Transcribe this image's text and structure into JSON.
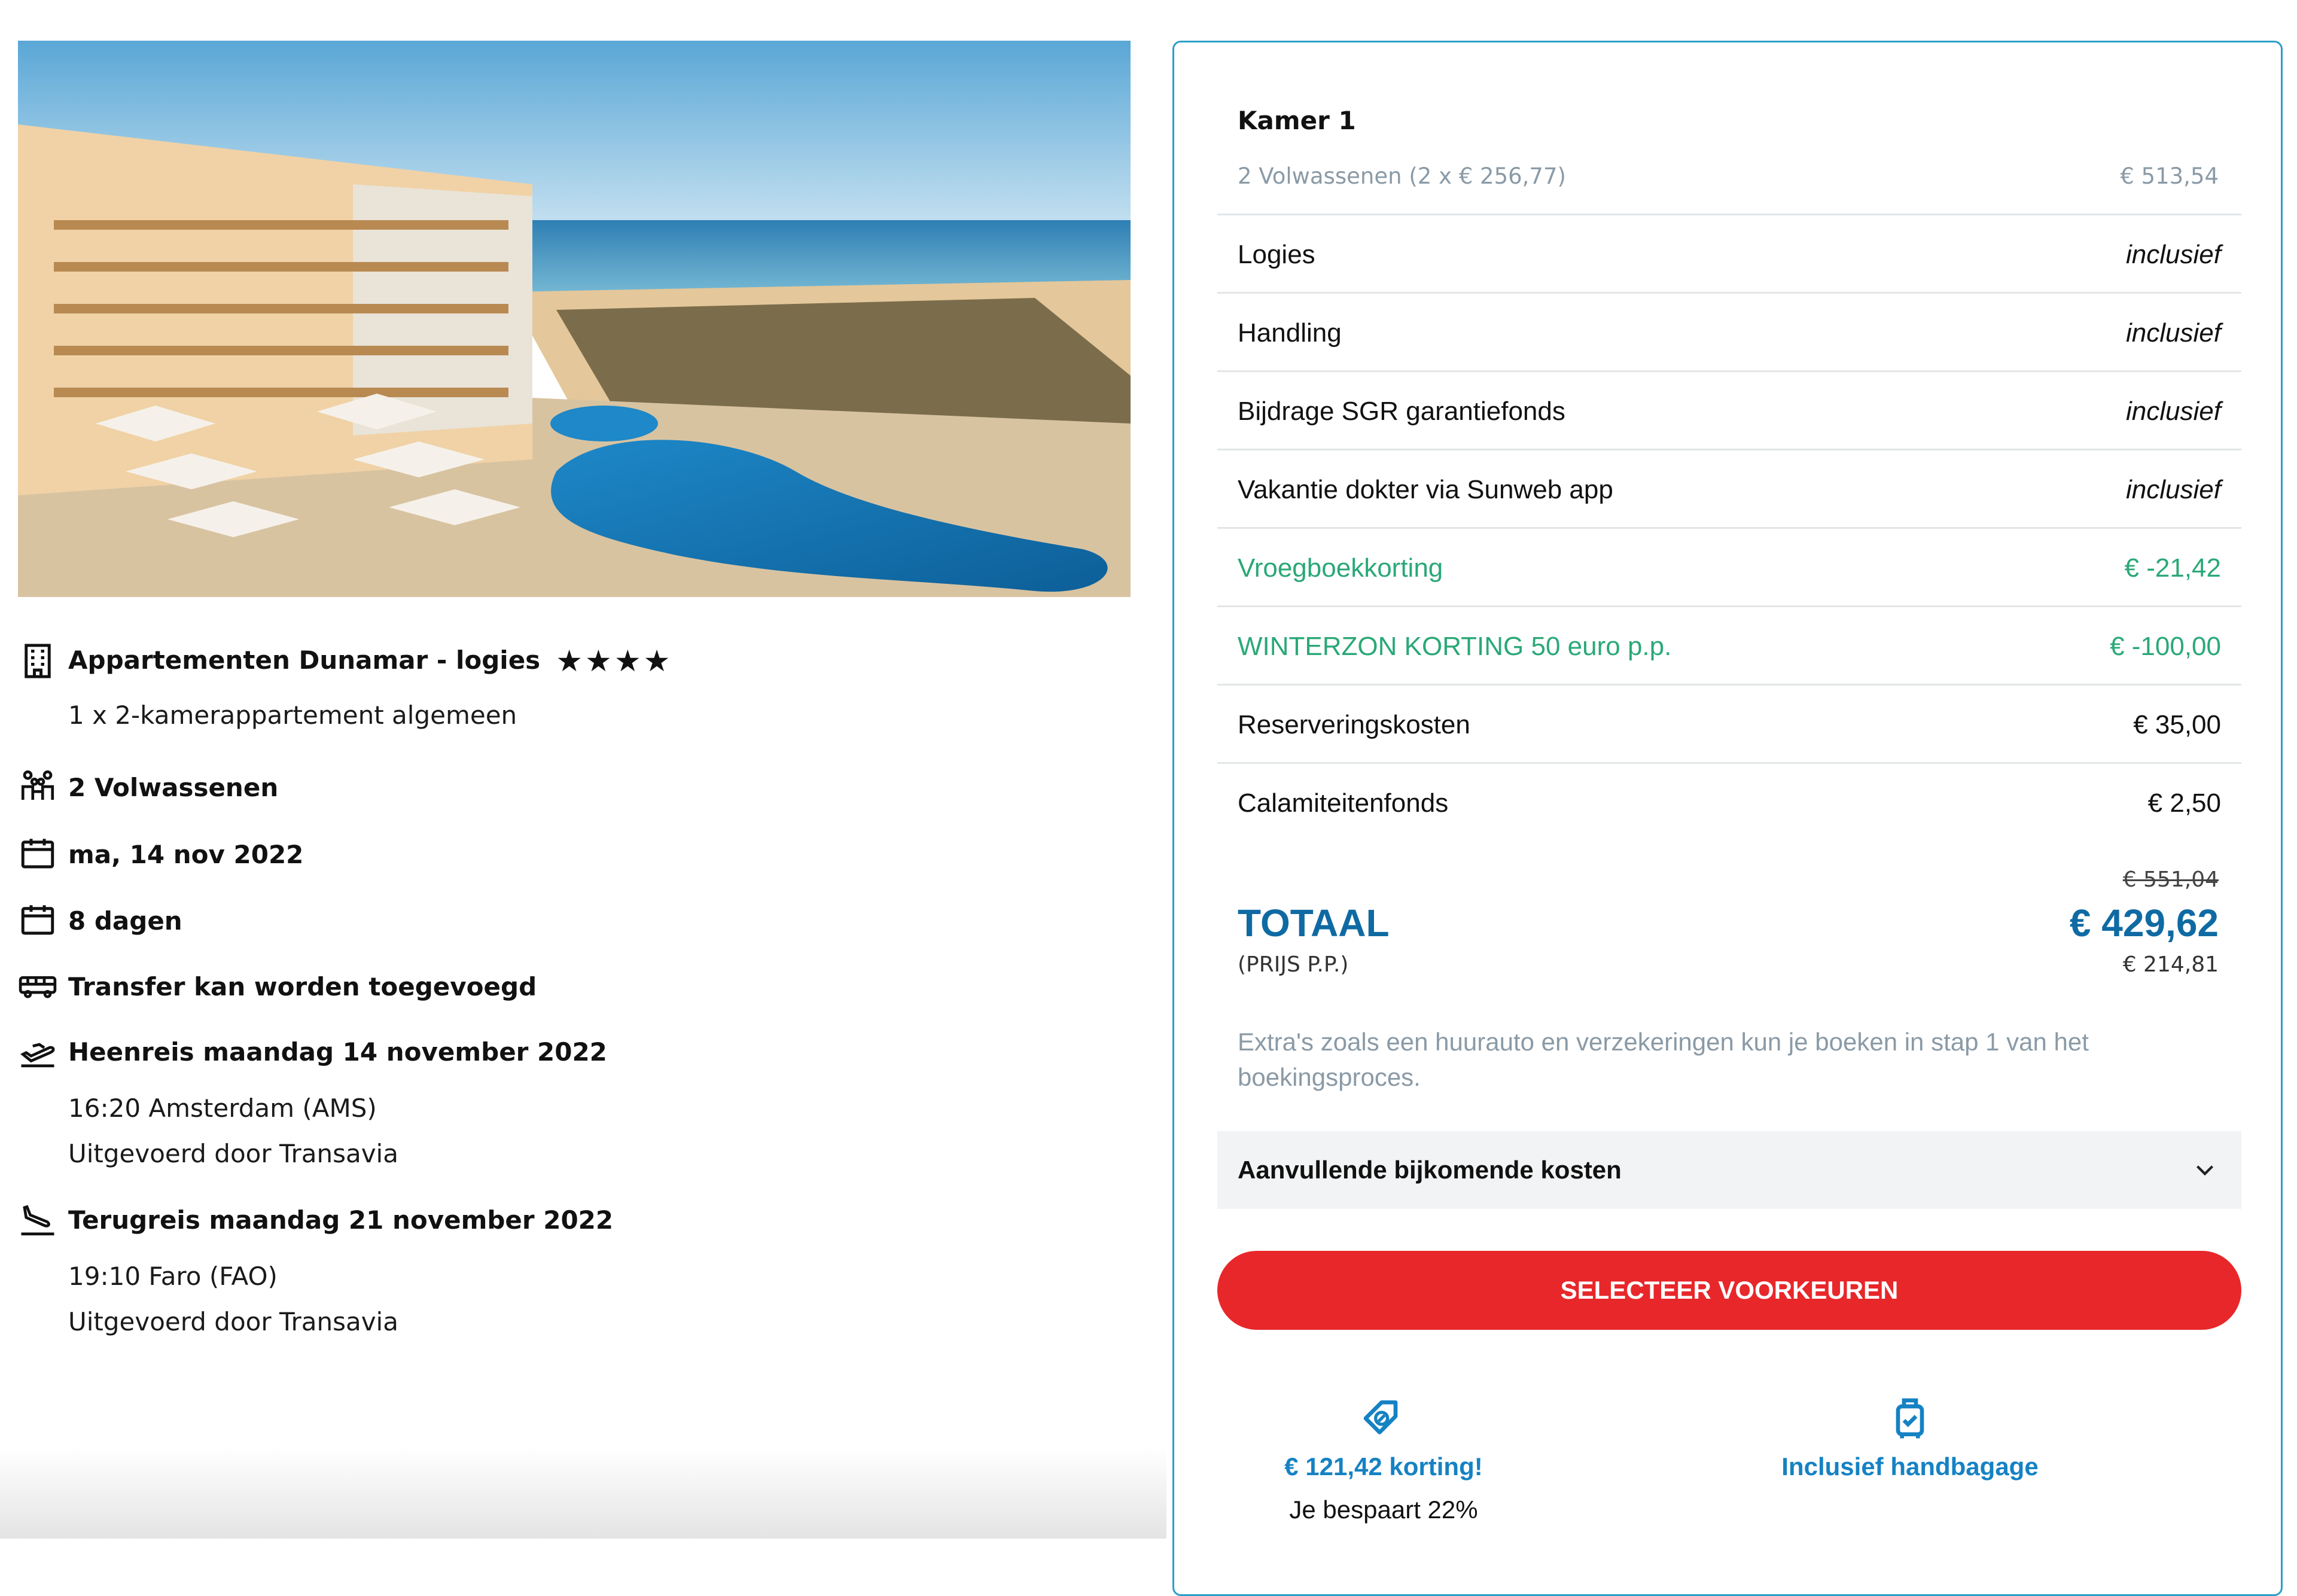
{
  "hotel": {
    "image_alt": "Hotel Dunamar - zwembad en strand",
    "name": "Appartementen Dunamar - logies",
    "stars": "★★★★",
    "room": "1 x 2-kamerappartement algemeen"
  },
  "details": {
    "travelers": "2 Volwassenen",
    "date": "ma, 14 nov 2022",
    "duration": "8 dagen",
    "transfer": "Transfer kan worden toegevoegd",
    "outbound": {
      "title": "Heenreis maandag 14 november 2022",
      "time": "16:20 Amsterdam (AMS)",
      "carrier": "Uitgevoerd door Transavia"
    },
    "return": {
      "title": "Terugreis maandag 21 november 2022",
      "time": "19:10 Faro (FAO)",
      "carrier": "Uitgevoerd door Transavia"
    }
  },
  "price": {
    "room_title": "Kamer 1",
    "room_sub": "2 Volwassenen (2 x € 256,77)",
    "room_sub_price": "€ 513,54",
    "rows": [
      {
        "label": "Logies",
        "value": "inclusief"
      },
      {
        "label": "Handling",
        "value": "inclusief"
      },
      {
        "label": "Bijdrage SGR garantiefonds",
        "value": "inclusief"
      },
      {
        "label": "Vakantie dokter via Sunweb app",
        "value": "inclusief"
      },
      {
        "label": "Vroegboekkorting",
        "value": "€ -21,42"
      },
      {
        "label": "WINTERZON KORTING 50 euro p.p.",
        "value": "€ -100,00"
      },
      {
        "label": "Reserveringskosten",
        "value": "€ 35,00"
      },
      {
        "label": "Calamiteitenfonds",
        "value": "€ 2,50"
      }
    ],
    "old_total": "€ 551,04",
    "total_label": "TOTAAL",
    "total": "€ 429,62",
    "pp_label": "(PRIJS P.P.)",
    "pp_price": "€ 214,81",
    "note": "Extra's zoals een huurauto en verzekeringen kun je boeken in stap 1 van het boekingsproces.",
    "accordion_label": "Aanvullende bijkomende kosten",
    "cta": "SELECTEER VOORKEUREN",
    "perks": [
      {
        "title": "€ 121,42 korting!",
        "sub": "Je bespaart 22%"
      },
      {
        "title": "Inclusief handbagage",
        "sub": ""
      }
    ]
  },
  "colors": {
    "accent_blue": "#0f6aa3",
    "link_blue": "#1582c3",
    "discount_green": "#2aa878",
    "cta_red": "#e8272a",
    "panel_border": "#2c9fc7"
  }
}
